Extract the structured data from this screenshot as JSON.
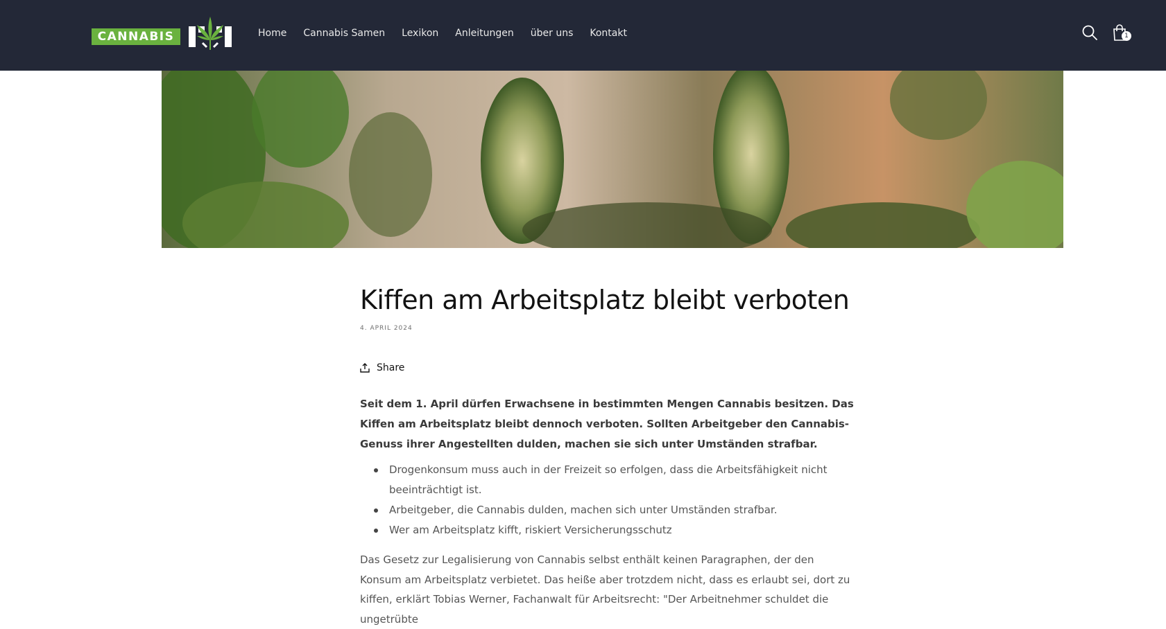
{
  "header": {
    "logo_text": "CANNABIS",
    "nav": [
      "Home",
      "Cannabis Samen",
      "Lexikon",
      "Anleitungen",
      "über uns",
      "Kontakt"
    ],
    "cart_count": "1",
    "search_icon": "search-icon",
    "cart_icon": "shopping-bag-icon"
  },
  "article": {
    "title": "Kiffen am Arbeitsplatz bleibt verboten",
    "date": "4. APRIL 2024",
    "share_label": "Share",
    "lead": "Seit dem 1. April dürfen Erwachsene in bestimmten Mengen Cannabis besitzen. Das Kiffen am Arbeitsplatz bleibt dennoch verboten. Sollten Arbeitgeber den Cannabis-Genuss ihrer Angestellten dulden, machen sie sich unter Umständen strafbar.",
    "points": [
      "Drogenkonsum muss auch in der Freizeit so erfolgen, dass die Arbeitsfähigkeit nicht beeinträchtigt ist.",
      "Arbeitgeber, die Cannabis dulden, machen sich unter Umständen strafbar.",
      "Wer am Arbeitsplatz kifft, riskiert Versicherungsschutz"
    ],
    "body": "Das Gesetz zur Legalisierung von Cannabis selbst enthält keinen Paragraphen, der den Konsum am Arbeitsplatz verbietet. Das heiße aber trotzdem nicht, dass es erlaubt sei, dort zu kiffen, erklärt Tobias Werner, Fachanwalt für Arbeitsrecht: \"Der Arbeitnehmer schuldet die ungetrübte"
  },
  "colors": {
    "header_bg": "#232837",
    "logo_green": "#6ab23f"
  }
}
